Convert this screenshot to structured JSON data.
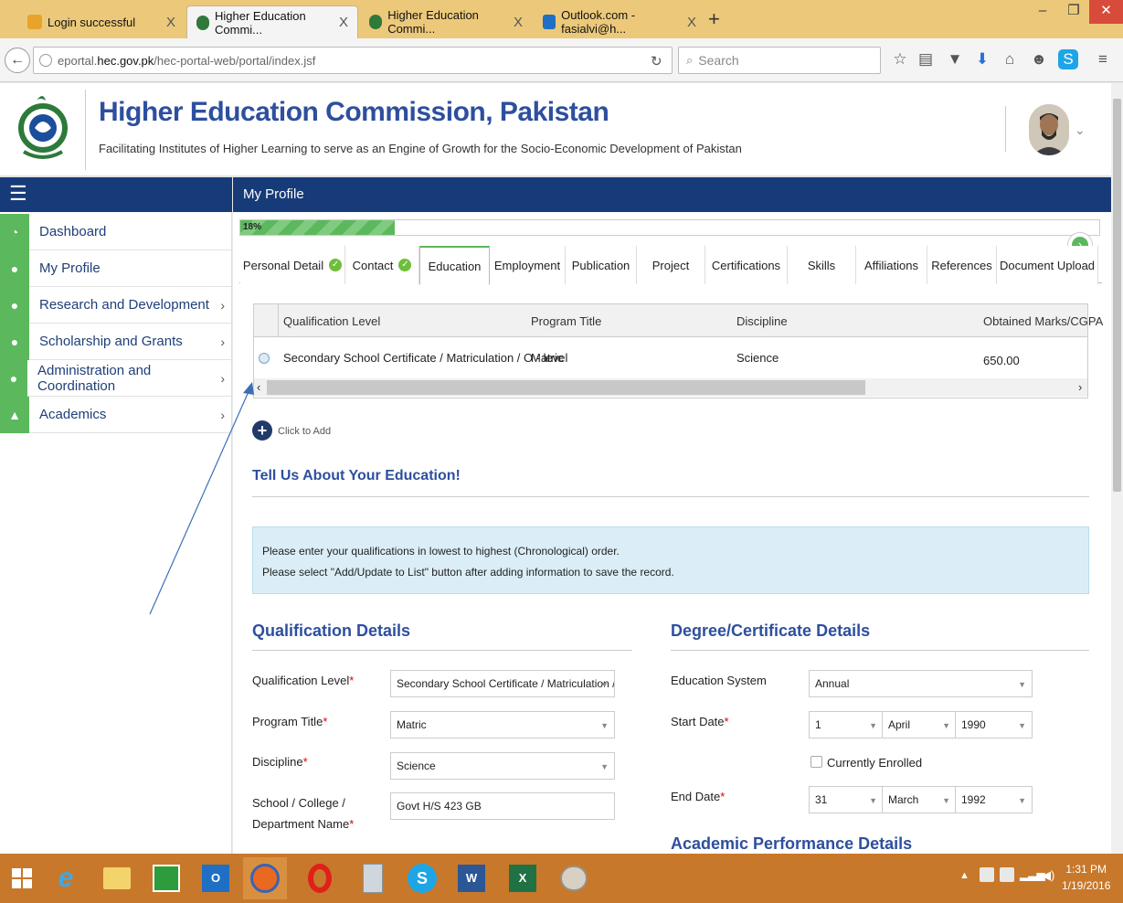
{
  "browser": {
    "tabs": [
      {
        "title": "Login successful",
        "active": false
      },
      {
        "title": "Higher Education Commi...",
        "active": true
      },
      {
        "title": "Higher Education Commi...",
        "active": false
      },
      {
        "title": "Outlook.com - fasialvi@h...",
        "active": false
      }
    ],
    "url_prefix": "eportal.",
    "url_domain": "hec.gov.pk",
    "url_path": "/hec-portal-web/portal/index.jsf",
    "search_placeholder": "Search",
    "close_glyph": "X",
    "new_tab_glyph": "+"
  },
  "header": {
    "title": "Higher Education Commission, Pakistan",
    "subtitle": "Facilitating Institutes of Higher Learning to serve as an Engine of Growth for the Socio-Economic Development of Pakistan"
  },
  "sidebar": {
    "items": [
      {
        "label": "Dashboard",
        "icon": "dashboard-icon",
        "has_children": false
      },
      {
        "label": "My Profile",
        "icon": "user-icon",
        "has_children": false
      },
      {
        "label": "Research and Development",
        "icon": "user-icon",
        "has_children": true
      },
      {
        "label": "Scholarship and Grants",
        "icon": "user-icon",
        "has_children": true
      },
      {
        "label": "Administration and Coordination",
        "icon": "user-icon",
        "has_children": true
      },
      {
        "label": "Academics",
        "icon": "graduation-cap-icon",
        "has_children": true
      }
    ]
  },
  "page": {
    "title": "My Profile",
    "progress_label": "18%",
    "progress_value": 18
  },
  "profile_tabs": [
    {
      "label": "Personal Detail",
      "done": true
    },
    {
      "label": "Contact",
      "done": true
    },
    {
      "label": "Education",
      "done": false,
      "active": true
    },
    {
      "label": "Employment",
      "done": false
    },
    {
      "label": "Publication",
      "done": false
    },
    {
      "label": "Project",
      "done": false
    },
    {
      "label": "Certifications",
      "done": false
    },
    {
      "label": "Skills",
      "done": false
    },
    {
      "label": "Affiliations",
      "done": false
    },
    {
      "label": "References",
      "done": false
    },
    {
      "label": "Document Upload",
      "done": false
    }
  ],
  "grid": {
    "columns": [
      "Qualification Level",
      "Program Title",
      "Discipline",
      "Obtained Marks/CGPA"
    ],
    "rows": [
      [
        "Secondary School Certificate / Matriculation / O - level",
        "Matric",
        "Science",
        "650.00"
      ]
    ],
    "add_label": "Click to Add"
  },
  "education": {
    "heading": "Tell Us About Your Education!",
    "notice_lines": [
      "Please enter your qualifications in lowest to highest (Chronological) order.",
      "Please select \"Add/Update to List\" button after adding information to save the record."
    ],
    "qualification_heading": "Qualification Details",
    "degree_heading": "Degree/Certificate Details",
    "academic_heading": "Academic Performance Details",
    "fields": {
      "qualification_level_label": "Qualification Level",
      "qualification_level_value": "Secondary School Certificate / Matriculation / (",
      "program_title_label": "Program Title",
      "program_title_value": "Matric",
      "discipline_label": "Discipline",
      "discipline_value": "Science",
      "school_label_1": "School / College /",
      "school_label_2": "Department Name",
      "school_value": "Govt H/S 423 GB",
      "education_system_label": "Education System",
      "education_system_value": "Annual",
      "start_date_label": "Start Date",
      "start_day": "1",
      "start_month": "April",
      "start_year": "1990",
      "currently_enrolled_label": "Currently Enrolled",
      "end_date_label": "End Date",
      "end_day": "31",
      "end_month": "March",
      "end_year": "1992",
      "required_mark": "*"
    }
  },
  "taskbar": {
    "time": "1:31 PM",
    "date": "1/19/2016"
  },
  "colors": {
    "brand_blue": "#173b78",
    "title_blue": "#2e4f9e",
    "success_green": "#5cb85c",
    "taskbar": "#c8782a"
  }
}
